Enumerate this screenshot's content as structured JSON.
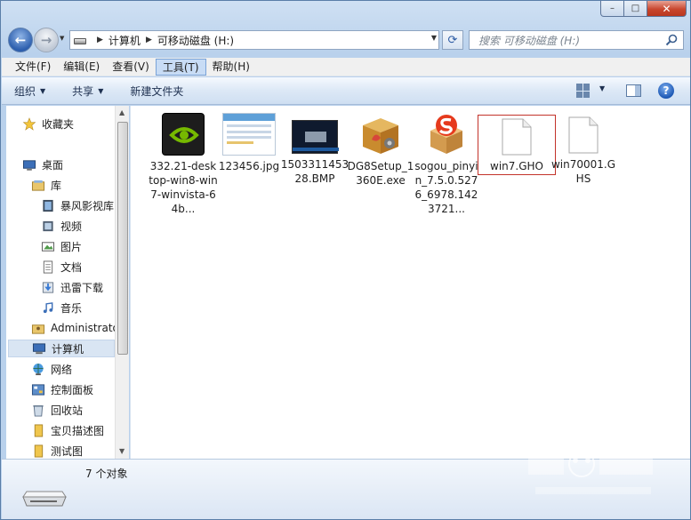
{
  "window": {
    "caption": {
      "minimize": "–",
      "maximize": "□",
      "close": "✕"
    }
  },
  "address_bar": {
    "crumbs": [
      "计算机",
      "可移动磁盘 (H:)"
    ]
  },
  "search": {
    "placeholder": "搜索 可移动磁盘 (H:)"
  },
  "menu": {
    "items": [
      "文件(F)",
      "编辑(E)",
      "查看(V)",
      "工具(T)",
      "帮助(H)"
    ],
    "active": "工具(T)"
  },
  "toolbar": {
    "organize": "组织",
    "share": "共享",
    "new_folder": "新建文件夹",
    "help": "?"
  },
  "nav": {
    "items": [
      {
        "label": "收藏夹",
        "icon": "star-icon"
      },
      {
        "label": "桌面",
        "icon": "desktop-icon"
      },
      {
        "label": "库",
        "icon": "library-icon"
      },
      {
        "label": "暴风影视库",
        "icon": "film-library-icon"
      },
      {
        "label": "视频",
        "icon": "video-icon"
      },
      {
        "label": "图片",
        "icon": "picture-icon"
      },
      {
        "label": "文档",
        "icon": "document-icon"
      },
      {
        "label": "迅雷下载",
        "icon": "download-icon"
      },
      {
        "label": "音乐",
        "icon": "music-icon"
      },
      {
        "label": "Administrator",
        "icon": "user-folder-icon"
      },
      {
        "label": "计算机",
        "icon": "computer-icon"
      },
      {
        "label": "网络",
        "icon": "network-icon"
      },
      {
        "label": "控制面板",
        "icon": "control-panel-icon"
      },
      {
        "label": "回收站",
        "icon": "recycle-bin-icon"
      },
      {
        "label": "宝贝描述图",
        "icon": "folder-icon"
      },
      {
        "label": "测试图",
        "icon": "folder-icon"
      }
    ],
    "selected": "计算机"
  },
  "files": [
    {
      "name": "332.21-desktop-win8-win7-winvista-64b...",
      "icon": "nvidia-installer-icon"
    },
    {
      "name": "123456.jpg",
      "icon": "image-thumbnail-icon"
    },
    {
      "name": "150331145328.BMP",
      "icon": "bmp-thumbnail-icon"
    },
    {
      "name": "DG8Setup_1360E.exe",
      "icon": "setup-box-icon"
    },
    {
      "name": "sogou_pinyin_7.5.0.5276_6978.1423721...",
      "icon": "sogou-installer-icon"
    },
    {
      "name": "win7.GHO",
      "icon": "blank-file-icon"
    },
    {
      "name": "win70001.GHS",
      "icon": "blank-file-icon"
    }
  ],
  "status": {
    "count": "7 个对象"
  },
  "colors": {
    "selection_border": "#c3332a",
    "accent_blue": "#2d5fae",
    "nav_selected": "#d9e5f3"
  }
}
